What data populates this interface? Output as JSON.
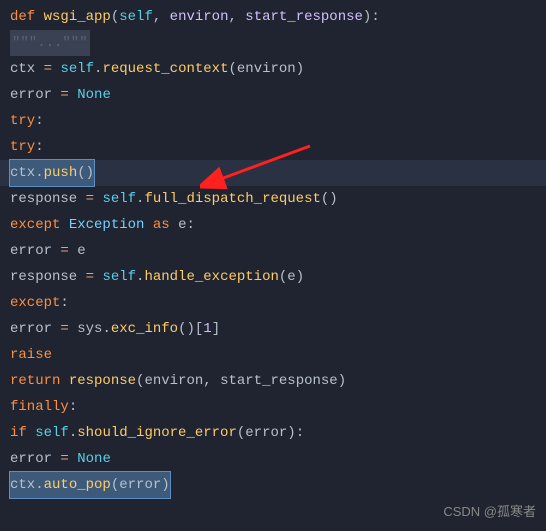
{
  "code": {
    "l1_def": "def",
    "l1_name": " wsgi_app",
    "l1_paren_open": "(",
    "l1_self": "self",
    "l1_c1": ", ",
    "l1_p1": "environ",
    "l1_c2": ", ",
    "l1_p2": "start_response",
    "l1_paren_close": "):",
    "l2_doc": "\"\"\"...\"\"\"",
    "l3_var": "ctx",
    "l3_op": " = ",
    "l3_self": "self",
    "l3_dot": ".",
    "l3_fn": "request_context",
    "l3_po": "(",
    "l3_arg": "environ",
    "l3_pc": ")",
    "l4_var": "error",
    "l4_op": " = ",
    "l4_val": "None",
    "l5_kw": "try",
    "l5_c": ":",
    "l6_kw": "try",
    "l6_c": ":",
    "l7_var": "ctx",
    "l7_dot": ".",
    "l7_fn": "push",
    "l7_pc": "()",
    "l8_var": "response",
    "l8_op": " = ",
    "l8_self": "self",
    "l8_dot": ".",
    "l8_fn": "full_dispatch_request",
    "l8_pc": "()",
    "l9_kw1": "except",
    "l9_sp": " ",
    "l9_cls": "Exception",
    "l9_sp2": " ",
    "l9_as": "as",
    "l9_sp3": " ",
    "l9_var": "e",
    "l9_c": ":",
    "l10_var": "error",
    "l10_op": " = ",
    "l10_val": "e",
    "l11_var": "response",
    "l11_op": " = ",
    "l11_self": "self",
    "l11_dot": ".",
    "l11_fn": "handle_exception",
    "l11_po": "(",
    "l11_arg": "e",
    "l11_pc": ")",
    "l12_kw": "except",
    "l12_c": ":",
    "l13_var": "error",
    "l13_op": " = ",
    "l13_mod": "sys",
    "l13_dot": ".",
    "l13_fn": "exc_info",
    "l13_pc": "()[",
    "l13_idx": "1",
    "l13_pc2": "]",
    "l14_kw": "raise",
    "l15_kw": "return",
    "l15_sp": " ",
    "l15_fn": "response",
    "l15_po": "(",
    "l15_a1": "environ",
    "l15_c": ", ",
    "l15_a2": "start_response",
    "l15_pc": ")",
    "l16_kw": "finally",
    "l16_c": ":",
    "l17_kw": "if",
    "l17_sp": " ",
    "l17_self": "self",
    "l17_dot": ".",
    "l17_fn": "should_ignore_error",
    "l17_po": "(",
    "l17_arg": "error",
    "l17_pc": "):",
    "l18_var": "error",
    "l18_op": " = ",
    "l18_val": "None",
    "l19_var": "ctx",
    "l19_dot": ".",
    "l19_fn": "auto_pop",
    "l19_po": "(",
    "l19_arg": "error",
    "l19_pc": ")"
  },
  "watermark": "CSDN @孤寒者"
}
